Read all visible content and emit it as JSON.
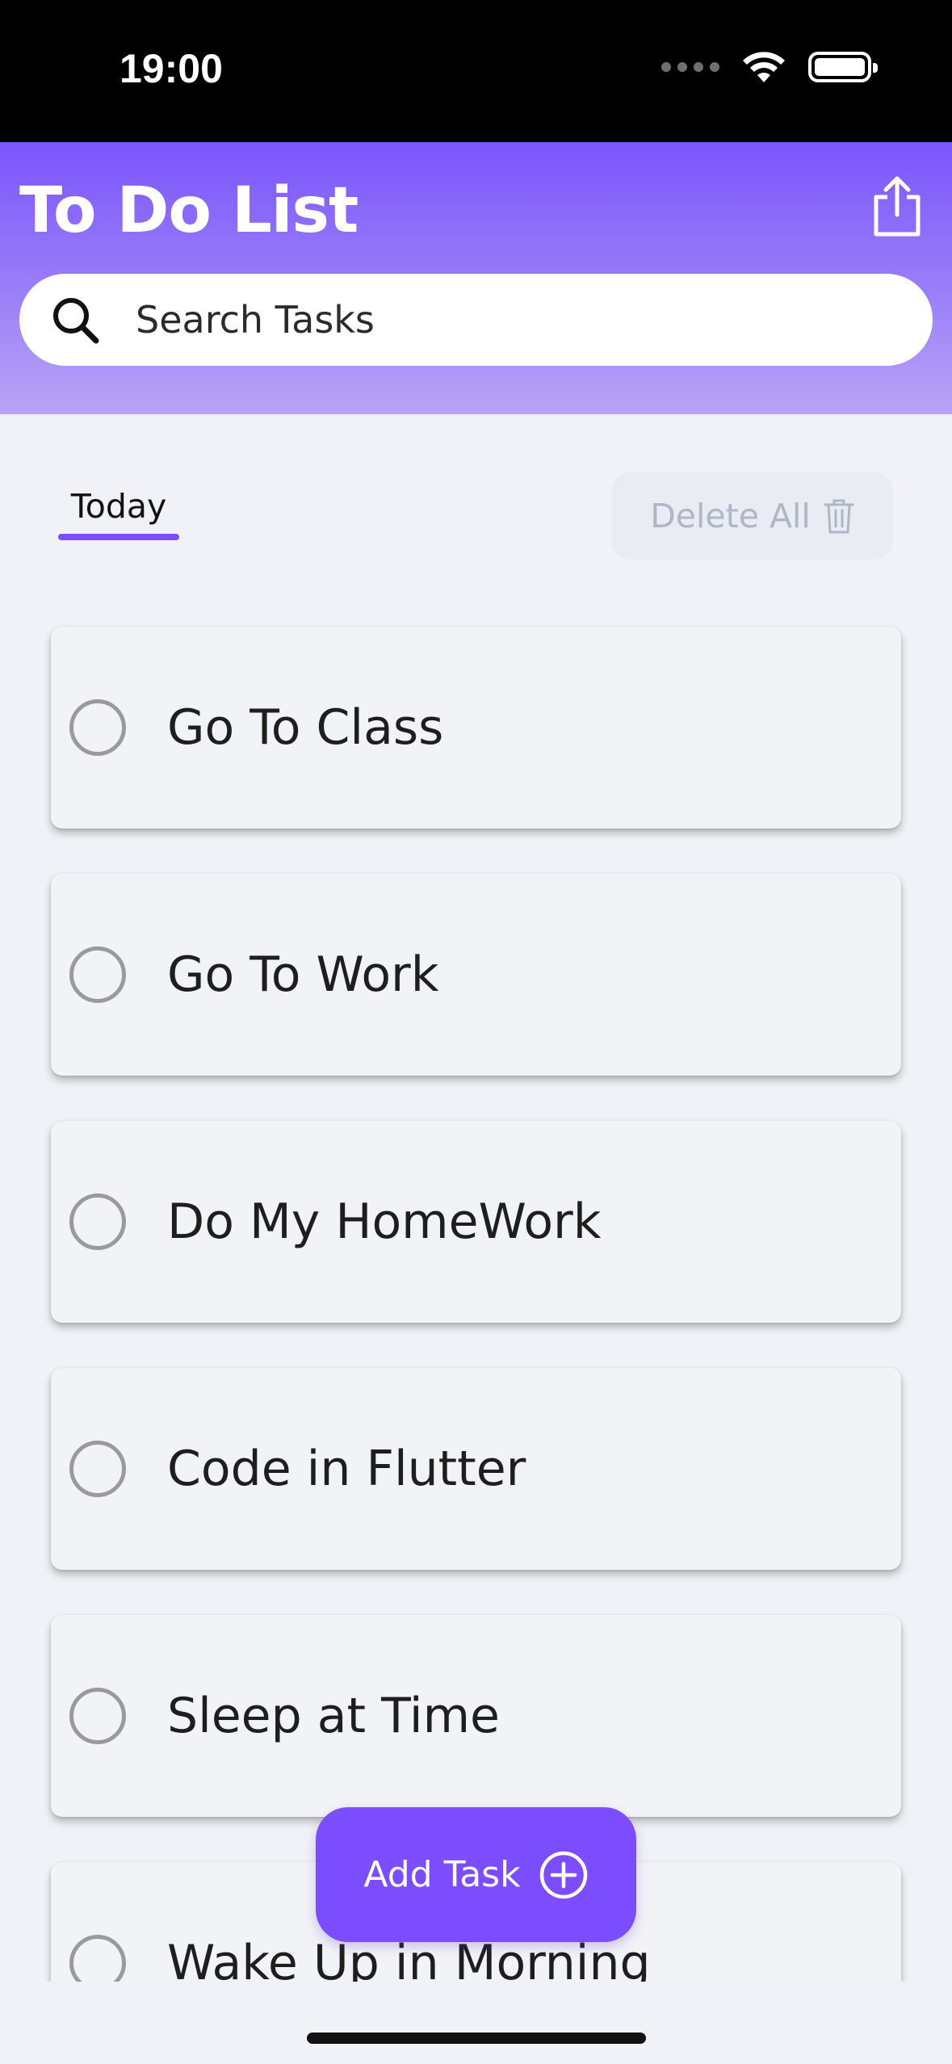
{
  "status_bar": {
    "time": "19:00"
  },
  "header": {
    "title": "To Do List",
    "share_icon": "share-icon"
  },
  "search": {
    "placeholder": "Search Tasks",
    "icon": "search-icon"
  },
  "filter": {
    "tab_label": "Today",
    "delete_all_label": "Delete All",
    "delete_icon": "trash-icon"
  },
  "tasks": [
    {
      "label": "Go To Class",
      "done": false
    },
    {
      "label": "Go To Work",
      "done": false
    },
    {
      "label": "Do My HomeWork",
      "done": false
    },
    {
      "label": "Code in Flutter",
      "done": false
    },
    {
      "label": "Sleep at Time",
      "done": false
    },
    {
      "label": "Wake Up in Morning",
      "done": false
    }
  ],
  "fab": {
    "label": "Add Task",
    "icon": "plus-circle-icon"
  },
  "colors": {
    "accent": "#7c4dff",
    "header_gradient_top": "#7b55fb",
    "header_gradient_bottom": "#b8a4f6",
    "background": "#f1f2f7"
  }
}
